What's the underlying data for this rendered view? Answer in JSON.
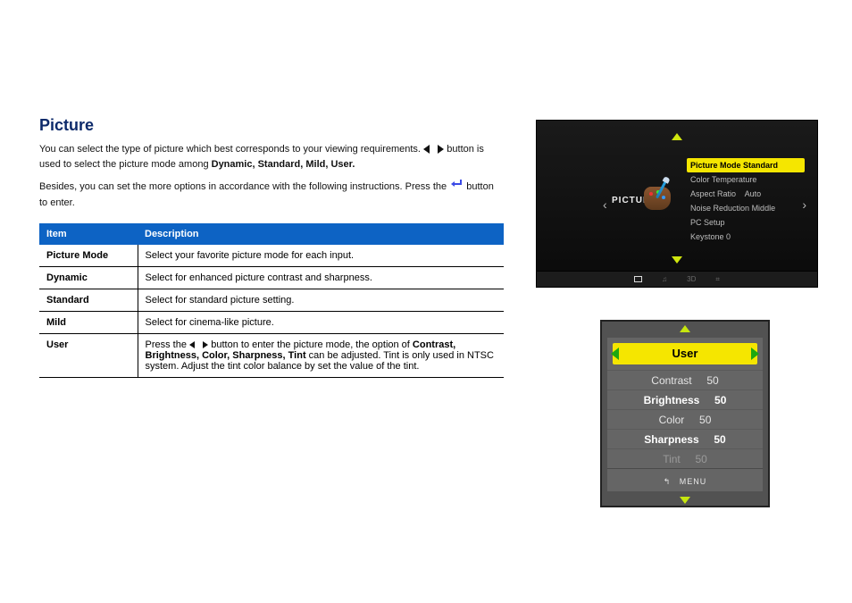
{
  "title": "Picture",
  "intro_line1_prefix": "You can select the type of picture which best corresponds to your viewing requirements. ",
  "intro_line1_mid": "button is used to select the picture mode among ",
  "intro_line1_suffix": "Dynamic, Standard, Mild, User.",
  "intro_line2_prefix": "Besides, you can set the more options in accordance with the following instructions. Press the ",
  "intro_line2_suffix": " button to enter.",
  "table": {
    "col_item": "Item",
    "col_desc": "Description",
    "rows": [
      {
        "item": "Picture Mode",
        "desc": "Select your favorite picture mode for each input."
      },
      {
        "item": "Dynamic",
        "desc": "Select for enhanced picture contrast and sharpness."
      },
      {
        "item": "Standard",
        "desc": "Select for standard picture setting."
      },
      {
        "item": "Mild",
        "desc": "Select for cinema-like picture."
      },
      {
        "item": "User",
        "desc_prefix": "Press the ",
        "desc_mid": " button to enter the picture mode, the option of ",
        "desc_list": "Contrast, Brightness, Color, Sharpness, Tint",
        "desc_suffix": " can be adjusted. Tint is only used in NTSC system. Adjust the tint color balance by set the value of the tint."
      }
    ]
  },
  "osd_main": {
    "label": "PICTURE",
    "items": [
      {
        "label": "Picture Mode",
        "value": "Standard",
        "selected": true
      },
      {
        "label": "Color Temperature",
        "value": ""
      },
      {
        "label": "Aspect Ratio",
        "value": "Auto"
      },
      {
        "label": "Noise Reduction",
        "value": "Middle"
      },
      {
        "label": "PC Setup",
        "value": ""
      },
      {
        "label": "Keystone",
        "value": "0"
      }
    ],
    "dock": [
      "picture-icon",
      "music-icon",
      "3D",
      "apps-icon"
    ]
  },
  "osd_user": {
    "header": "User",
    "rows": [
      {
        "label": "Contrast",
        "value": "50",
        "dim": false,
        "bold": false
      },
      {
        "label": "Brightness",
        "value": "50",
        "dim": false,
        "bold": true
      },
      {
        "label": "Color",
        "value": "50",
        "dim": false,
        "bold": false
      },
      {
        "label": "Sharpness",
        "value": "50",
        "dim": false,
        "bold": true
      },
      {
        "label": "Tint",
        "value": "50",
        "dim": true,
        "bold": false
      }
    ],
    "menu_label": "MENU"
  }
}
